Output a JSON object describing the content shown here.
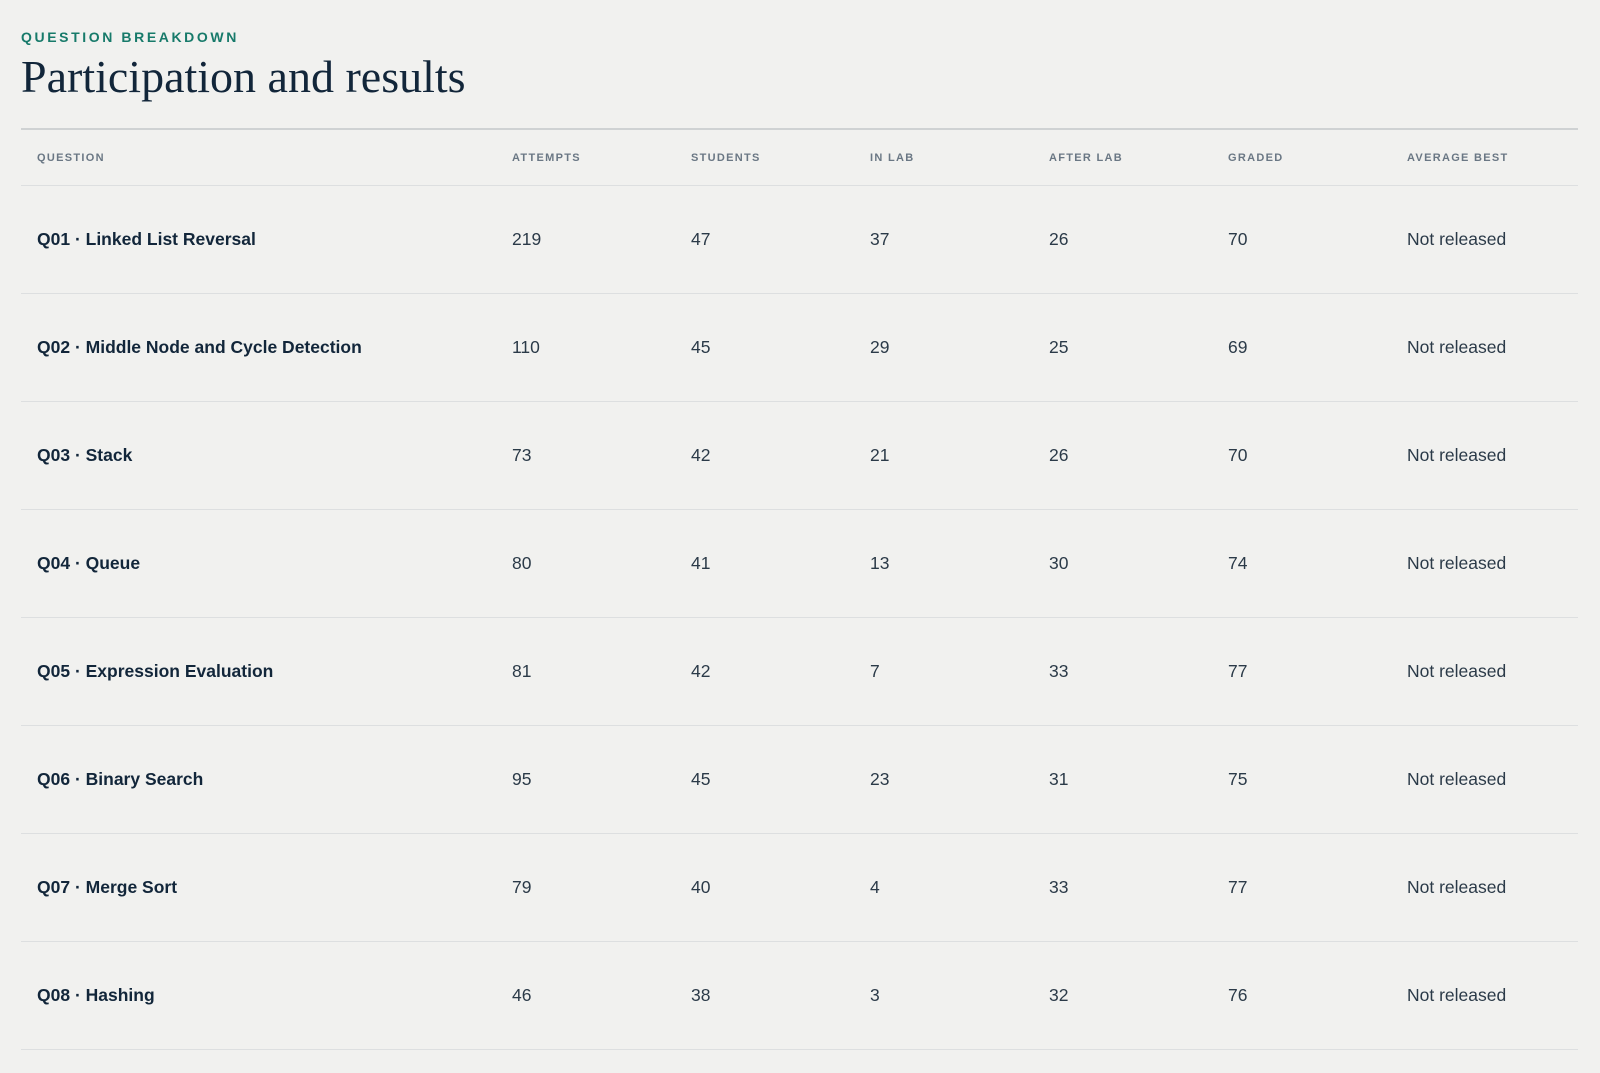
{
  "header": {
    "eyebrow": "QUESTION BREAKDOWN",
    "title": "Participation and results"
  },
  "table": {
    "columns": [
      "QUESTION",
      "ATTEMPTS",
      "STUDENTS",
      "IN LAB",
      "AFTER LAB",
      "GRADED",
      "AVERAGE BEST"
    ],
    "rows": [
      {
        "question": "Q01 · Linked List Reversal",
        "attempts": "219",
        "students": "47",
        "in_lab": "37",
        "after_lab": "26",
        "graded": "70",
        "average_best": "Not released"
      },
      {
        "question": "Q02 · Middle Node and Cycle Detection",
        "attempts": "110",
        "students": "45",
        "in_lab": "29",
        "after_lab": "25",
        "graded": "69",
        "average_best": "Not released"
      },
      {
        "question": "Q03 · Stack",
        "attempts": "73",
        "students": "42",
        "in_lab": "21",
        "after_lab": "26",
        "graded": "70",
        "average_best": "Not released"
      },
      {
        "question": "Q04 · Queue",
        "attempts": "80",
        "students": "41",
        "in_lab": "13",
        "after_lab": "30",
        "graded": "74",
        "average_best": "Not released"
      },
      {
        "question": "Q05 · Expression Evaluation",
        "attempts": "81",
        "students": "42",
        "in_lab": "7",
        "after_lab": "33",
        "graded": "77",
        "average_best": "Not released"
      },
      {
        "question": "Q06 · Binary Search",
        "attempts": "95",
        "students": "45",
        "in_lab": "23",
        "after_lab": "31",
        "graded": "75",
        "average_best": "Not released"
      },
      {
        "question": "Q07 · Merge Sort",
        "attempts": "79",
        "students": "40",
        "in_lab": "4",
        "after_lab": "33",
        "graded": "77",
        "average_best": "Not released"
      },
      {
        "question": "Q08 · Hashing",
        "attempts": "46",
        "students": "38",
        "in_lab": "3",
        "after_lab": "32",
        "graded": "76",
        "average_best": "Not released"
      }
    ]
  },
  "colors": {
    "background": "#f1f1ef",
    "eyebrow": "#177a6a",
    "title": "#12263a",
    "header_text": "#6a7784",
    "divider": "#dddfe0"
  }
}
